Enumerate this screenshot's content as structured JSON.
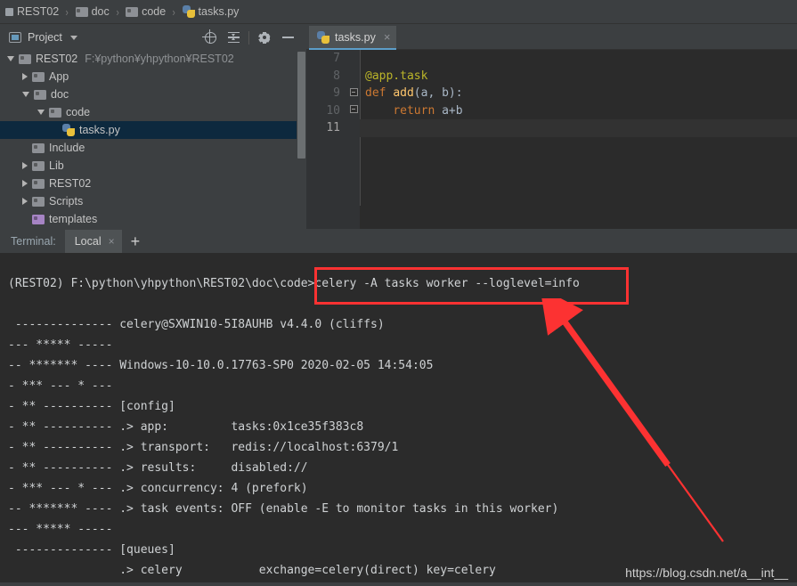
{
  "breadcrumb": {
    "items": [
      {
        "label": "REST02",
        "icon": "module-icon"
      },
      {
        "label": "doc",
        "icon": "folder-icon"
      },
      {
        "label": "code",
        "icon": "folder-icon"
      },
      {
        "label": "tasks.py",
        "icon": "python-file-icon"
      }
    ],
    "separator": "›"
  },
  "project_panel": {
    "title": "Project",
    "dropdown_caret": "▾",
    "tools": [
      {
        "name": "locate-icon",
        "tooltip": "Select Opened File"
      },
      {
        "name": "collapse-all-icon",
        "tooltip": "Collapse All"
      },
      {
        "name": "gear-icon",
        "tooltip": "Settings"
      },
      {
        "name": "minimize-icon",
        "tooltip": "Hide"
      }
    ],
    "tree": [
      {
        "label": "REST02",
        "path": "F:¥python¥yhpython¥REST02",
        "icon": "folder-icon",
        "arrow": "open",
        "indent": 0,
        "selected": false
      },
      {
        "label": "App",
        "path": "",
        "icon": "folder-icon",
        "arrow": "closed",
        "indent": 1,
        "selected": false
      },
      {
        "label": "doc",
        "path": "",
        "icon": "folder-icon",
        "arrow": "open",
        "indent": 1,
        "selected": false
      },
      {
        "label": "code",
        "path": "",
        "icon": "folder-icon",
        "arrow": "open",
        "indent": 2,
        "selected": false
      },
      {
        "label": "tasks.py",
        "path": "",
        "icon": "python-file-icon",
        "arrow": "none",
        "indent": 3,
        "selected": true
      },
      {
        "label": "Include",
        "path": "",
        "icon": "folder-icon",
        "arrow": "none",
        "indent": 1,
        "selected": false
      },
      {
        "label": "Lib",
        "path": "",
        "icon": "folder-icon",
        "arrow": "closed",
        "indent": 1,
        "selected": false
      },
      {
        "label": "REST02",
        "path": "",
        "icon": "folder-icon",
        "arrow": "closed",
        "indent": 1,
        "selected": false
      },
      {
        "label": "Scripts",
        "path": "",
        "icon": "folder-icon",
        "arrow": "closed",
        "indent": 1,
        "selected": false
      },
      {
        "label": "templates",
        "path": "",
        "icon": "folder-purple-icon",
        "arrow": "none",
        "indent": 1,
        "selected": false
      }
    ]
  },
  "editor": {
    "tab": {
      "label": "tasks.py",
      "icon": "python-file-icon",
      "close": "×"
    },
    "lines": [
      {
        "number": "7",
        "current": false,
        "fold": "",
        "tokens": []
      },
      {
        "number": "8",
        "current": false,
        "fold": "",
        "tokens": [
          {
            "t": "@app.task",
            "c": "tk-dec"
          }
        ]
      },
      {
        "number": "9",
        "current": false,
        "fold": "-",
        "tokens": [
          {
            "t": "def ",
            "c": "tk-kw"
          },
          {
            "t": "add",
            "c": "tk-fn"
          },
          {
            "t": "(a, b):",
            "c": "tk-def"
          }
        ]
      },
      {
        "number": "10",
        "current": false,
        "fold": "-",
        "tokens": [
          {
            "t": "    ",
            "c": "tk-def"
          },
          {
            "t": "return ",
            "c": "tk-kw"
          },
          {
            "t": "a+b",
            "c": "tk-def"
          }
        ]
      },
      {
        "number": "11",
        "current": true,
        "fold": "",
        "tokens": []
      }
    ]
  },
  "terminal_panel": {
    "title": "Terminal:",
    "tab_label": "Local",
    "tab_close": "×",
    "add_label": "+",
    "lines": [
      "",
      "(REST02) F:\\python\\yhpython\\REST02\\doc\\code>celery -A tasks worker --loglevel=info",
      "",
      " -------------- celery@SXWIN10-5I8AUHB v4.4.0 (cliffs)",
      "--- ***** -----",
      "-- ******* ---- Windows-10-10.0.17763-SP0 2020-02-05 14:54:05",
      "- *** --- * ---",
      "- ** ---------- [config]",
      "- ** ---------- .> app:         tasks:0x1ce35f383c8",
      "- ** ---------- .> transport:   redis://localhost:6379/1",
      "- ** ---------- .> results:     disabled://",
      "- *** --- * --- .> concurrency: 4 (prefork)",
      "-- ******* ---- .> task events: OFF (enable -E to monitor tasks in this worker)",
      "--- ***** -----",
      " -------------- [queues]",
      "                .> celery           exchange=celery(direct) key=celery"
    ]
  },
  "annotations": {
    "highlight_box": {
      "color": "#fc3232",
      "target_text": "celery -A tasks worker --loglevel=info"
    },
    "arrow": {
      "color": "#fc3232"
    }
  },
  "watermark": "https://blog.csdn.net/a__int__"
}
